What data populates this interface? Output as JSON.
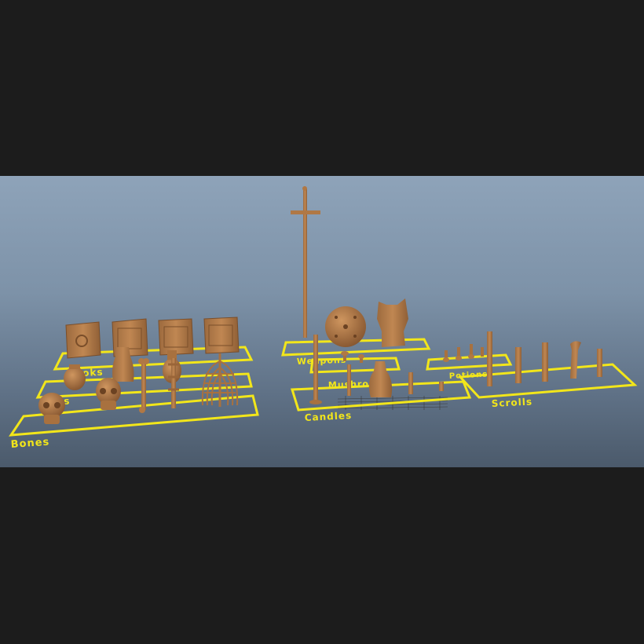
{
  "viewport": {
    "background_top": "#8ea3b9",
    "background_bottom": "#4b5a6b",
    "prop_color": "#b97f4c",
    "prop_shade": "#8a5a32",
    "label_color": "#f2e61a",
    "grid_color": "#3a3a3a"
  },
  "groups": {
    "books": {
      "label": "Books"
    },
    "jars": {
      "label": "Jars"
    },
    "bones": {
      "label": "Bones"
    },
    "weapons": {
      "label": "Weapons"
    },
    "mushrooms": {
      "label": "Mushrooms"
    },
    "candles": {
      "label": "Candles"
    },
    "potions": {
      "label": "Potions"
    },
    "scrolls": {
      "label": "Scrolls"
    }
  }
}
